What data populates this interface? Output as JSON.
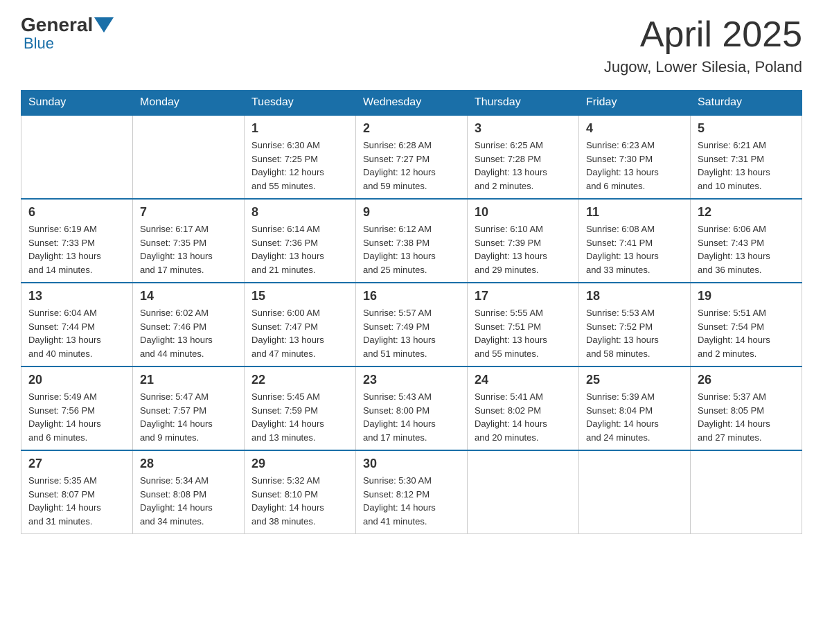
{
  "header": {
    "logo": {
      "general": "General",
      "blue": "Blue"
    },
    "title": "April 2025",
    "location": "Jugow, Lower Silesia, Poland"
  },
  "weekdays": [
    "Sunday",
    "Monday",
    "Tuesday",
    "Wednesday",
    "Thursday",
    "Friday",
    "Saturday"
  ],
  "weeks": [
    [
      {
        "day": "",
        "info": ""
      },
      {
        "day": "",
        "info": ""
      },
      {
        "day": "1",
        "info": "Sunrise: 6:30 AM\nSunset: 7:25 PM\nDaylight: 12 hours\nand 55 minutes."
      },
      {
        "day": "2",
        "info": "Sunrise: 6:28 AM\nSunset: 7:27 PM\nDaylight: 12 hours\nand 59 minutes."
      },
      {
        "day": "3",
        "info": "Sunrise: 6:25 AM\nSunset: 7:28 PM\nDaylight: 13 hours\nand 2 minutes."
      },
      {
        "day": "4",
        "info": "Sunrise: 6:23 AM\nSunset: 7:30 PM\nDaylight: 13 hours\nand 6 minutes."
      },
      {
        "day": "5",
        "info": "Sunrise: 6:21 AM\nSunset: 7:31 PM\nDaylight: 13 hours\nand 10 minutes."
      }
    ],
    [
      {
        "day": "6",
        "info": "Sunrise: 6:19 AM\nSunset: 7:33 PM\nDaylight: 13 hours\nand 14 minutes."
      },
      {
        "day": "7",
        "info": "Sunrise: 6:17 AM\nSunset: 7:35 PM\nDaylight: 13 hours\nand 17 minutes."
      },
      {
        "day": "8",
        "info": "Sunrise: 6:14 AM\nSunset: 7:36 PM\nDaylight: 13 hours\nand 21 minutes."
      },
      {
        "day": "9",
        "info": "Sunrise: 6:12 AM\nSunset: 7:38 PM\nDaylight: 13 hours\nand 25 minutes."
      },
      {
        "day": "10",
        "info": "Sunrise: 6:10 AM\nSunset: 7:39 PM\nDaylight: 13 hours\nand 29 minutes."
      },
      {
        "day": "11",
        "info": "Sunrise: 6:08 AM\nSunset: 7:41 PM\nDaylight: 13 hours\nand 33 minutes."
      },
      {
        "day": "12",
        "info": "Sunrise: 6:06 AM\nSunset: 7:43 PM\nDaylight: 13 hours\nand 36 minutes."
      }
    ],
    [
      {
        "day": "13",
        "info": "Sunrise: 6:04 AM\nSunset: 7:44 PM\nDaylight: 13 hours\nand 40 minutes."
      },
      {
        "day": "14",
        "info": "Sunrise: 6:02 AM\nSunset: 7:46 PM\nDaylight: 13 hours\nand 44 minutes."
      },
      {
        "day": "15",
        "info": "Sunrise: 6:00 AM\nSunset: 7:47 PM\nDaylight: 13 hours\nand 47 minutes."
      },
      {
        "day": "16",
        "info": "Sunrise: 5:57 AM\nSunset: 7:49 PM\nDaylight: 13 hours\nand 51 minutes."
      },
      {
        "day": "17",
        "info": "Sunrise: 5:55 AM\nSunset: 7:51 PM\nDaylight: 13 hours\nand 55 minutes."
      },
      {
        "day": "18",
        "info": "Sunrise: 5:53 AM\nSunset: 7:52 PM\nDaylight: 13 hours\nand 58 minutes."
      },
      {
        "day": "19",
        "info": "Sunrise: 5:51 AM\nSunset: 7:54 PM\nDaylight: 14 hours\nand 2 minutes."
      }
    ],
    [
      {
        "day": "20",
        "info": "Sunrise: 5:49 AM\nSunset: 7:56 PM\nDaylight: 14 hours\nand 6 minutes."
      },
      {
        "day": "21",
        "info": "Sunrise: 5:47 AM\nSunset: 7:57 PM\nDaylight: 14 hours\nand 9 minutes."
      },
      {
        "day": "22",
        "info": "Sunrise: 5:45 AM\nSunset: 7:59 PM\nDaylight: 14 hours\nand 13 minutes."
      },
      {
        "day": "23",
        "info": "Sunrise: 5:43 AM\nSunset: 8:00 PM\nDaylight: 14 hours\nand 17 minutes."
      },
      {
        "day": "24",
        "info": "Sunrise: 5:41 AM\nSunset: 8:02 PM\nDaylight: 14 hours\nand 20 minutes."
      },
      {
        "day": "25",
        "info": "Sunrise: 5:39 AM\nSunset: 8:04 PM\nDaylight: 14 hours\nand 24 minutes."
      },
      {
        "day": "26",
        "info": "Sunrise: 5:37 AM\nSunset: 8:05 PM\nDaylight: 14 hours\nand 27 minutes."
      }
    ],
    [
      {
        "day": "27",
        "info": "Sunrise: 5:35 AM\nSunset: 8:07 PM\nDaylight: 14 hours\nand 31 minutes."
      },
      {
        "day": "28",
        "info": "Sunrise: 5:34 AM\nSunset: 8:08 PM\nDaylight: 14 hours\nand 34 minutes."
      },
      {
        "day": "29",
        "info": "Sunrise: 5:32 AM\nSunset: 8:10 PM\nDaylight: 14 hours\nand 38 minutes."
      },
      {
        "day": "30",
        "info": "Sunrise: 5:30 AM\nSunset: 8:12 PM\nDaylight: 14 hours\nand 41 minutes."
      },
      {
        "day": "",
        "info": ""
      },
      {
        "day": "",
        "info": ""
      },
      {
        "day": "",
        "info": ""
      }
    ]
  ]
}
